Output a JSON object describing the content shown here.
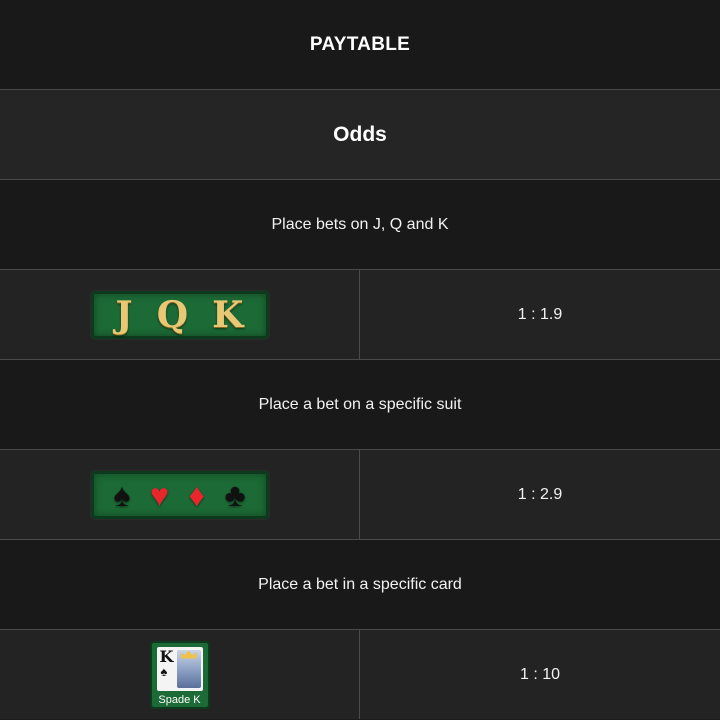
{
  "header": {
    "title": "PAYTABLE"
  },
  "section": {
    "subtitle": "Odds"
  },
  "bets": [
    {
      "description": "Place bets on J, Q and K",
      "icon": {
        "letters": [
          "J",
          "Q",
          "K"
        ]
      },
      "odds": "1 : 1.9"
    },
    {
      "description": "Place a bet on a specific suit",
      "icon": {
        "suits": [
          "♠",
          "♥",
          "♦",
          "♣"
        ]
      },
      "odds": "1 : 2.9"
    },
    {
      "description": "Place a bet in a specific card",
      "icon": {
        "rank": "K",
        "suit": "♠",
        "label": "Spade K"
      },
      "odds": "1 : 10"
    }
  ],
  "colors": {
    "badge_green": "#1c6a35",
    "gold": "#e8c874",
    "red_suit": "#e8262b"
  }
}
